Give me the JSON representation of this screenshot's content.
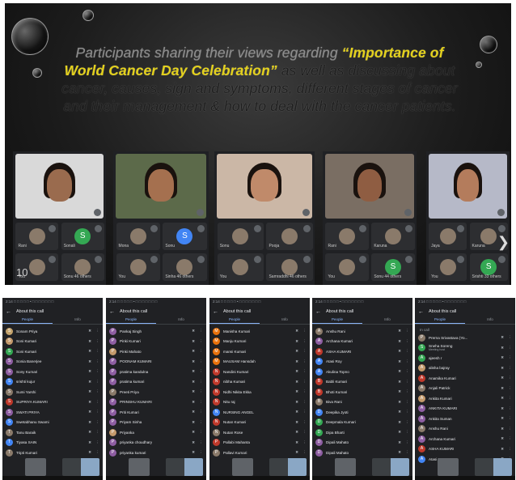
{
  "caption": {
    "p1": "Participants sharing their views regarding ",
    "p2": "“Importance of World Cancer Day Celebration”",
    "p3": " as well as discussing about cancer, causes, sign and symptoms, different stages of cancer and their management & how to deal with the cancer patients."
  },
  "page_number": "10",
  "next_arrow": "❯",
  "call_screens": [
    {
      "tiles": [
        {
          "name": "Rani",
          "letter": ""
        },
        {
          "name": "Sonali",
          "letter": "S"
        },
        {
          "name": "You",
          "letter": ""
        },
        {
          "name": "Sonu",
          "letter": "",
          "extra": "46 others"
        }
      ]
    },
    {
      "tiles": [
        {
          "name": "Mona",
          "letter": ""
        },
        {
          "name": "Sonu",
          "letter": "S"
        },
        {
          "name": "You",
          "letter": ""
        },
        {
          "name": "Sinha",
          "letter": "",
          "extra": "46 others"
        }
      ]
    },
    {
      "tiles": [
        {
          "name": "Sonu",
          "letter": ""
        },
        {
          "name": "Pooja",
          "letter": ""
        },
        {
          "name": "You",
          "letter": ""
        },
        {
          "name": "Samraddhi",
          "letter": "",
          "extra": "46 others"
        }
      ]
    },
    {
      "tiles": [
        {
          "name": "Rani",
          "letter": ""
        },
        {
          "name": "Karuna",
          "letter": ""
        },
        {
          "name": "You",
          "letter": ""
        },
        {
          "name": "Sonu",
          "letter": "S",
          "extra": "44 others"
        }
      ]
    },
    {
      "tiles": [
        {
          "name": "Jaya",
          "letter": ""
        },
        {
          "name": "Karuna",
          "letter": ""
        },
        {
          "name": "You",
          "letter": ""
        },
        {
          "name": "Srishti",
          "letter": "S",
          "extra": "33 others"
        }
      ]
    }
  ],
  "people_screens": [
    {
      "status": "2:14 □ □ □ □ □ •   □ □ □ □ □ □ □",
      "title": "About this call",
      "tab_people": "People",
      "tab_info": "Info",
      "rows": [
        {
          "name": "Sonam Priya",
          "color": "#c5a46d"
        },
        {
          "name": "Soni Kumari",
          "color": "#c49a6c"
        },
        {
          "name": "Soni Kumari",
          "color": "#34a853"
        },
        {
          "name": "Sonia Banerjee",
          "color": "#8e5ea2"
        },
        {
          "name": "Sony Kumari",
          "color": "#8e5ea2"
        },
        {
          "name": "srishti kujur",
          "color": "#4285f4"
        },
        {
          "name": "Sumi Yarshi",
          "color": "#8a7a6a"
        },
        {
          "name": "SUPRIYA KUMARI",
          "color": "#c0392b"
        },
        {
          "name": "SWATI PRIYA",
          "color": "#8e5ea2"
        },
        {
          "name": "Swetabhanu Swami",
          "color": "#4285f4"
        },
        {
          "name": "Tanu Baraik",
          "color": "#8a7a6a"
        },
        {
          "name": "Tiyasa SAIN",
          "color": "#4285f4"
        },
        {
          "name": "Tripti Kumari",
          "color": "#8a7a6a"
        }
      ]
    },
    {
      "status": "2:14 □ □ □ □ □ •   □ □ □ □ □ □ □",
      "title": "About this call",
      "tab_people": "People",
      "tab_info": "Info",
      "rows": [
        {
          "name": "Pankaj Singh",
          "color": "#8e5ea2"
        },
        {
          "name": "Pinki Kumari",
          "color": "#8e5ea2"
        },
        {
          "name": "Pinki Mahato",
          "color": "#c49a6c"
        },
        {
          "name": "POONAM KUMARI",
          "color": "#8e5ea2"
        },
        {
          "name": "pratima kandulna",
          "color": "#8e5ea2"
        },
        {
          "name": "pratima kumari",
          "color": "#8e5ea2"
        },
        {
          "name": "Preeti Priya",
          "color": "#8a7a6a"
        },
        {
          "name": "PRINSHU KUMARI",
          "color": "#8e5ea2"
        },
        {
          "name": "Priti Kumari",
          "color": "#8e5ea2"
        },
        {
          "name": "Priyam Sinha",
          "color": "#8e5ea2"
        },
        {
          "name": "Priyanka",
          "color": "#c49a6c"
        },
        {
          "name": "priyanka choudhary",
          "color": "#8e5ea2"
        },
        {
          "name": "priyanka kumari",
          "color": "#8e5ea2"
        }
      ]
    },
    {
      "status": "2:14 □ □ □ □ □ •   □ □ □ □ □ □ □",
      "title": "About this call",
      "tab_people": "People",
      "tab_info": "Info",
      "rows": [
        {
          "name": "Manisha Kumari",
          "color": "#e8710a"
        },
        {
          "name": "Manju Kumari",
          "color": "#e8710a"
        },
        {
          "name": "mansi Kumari",
          "color": "#e8710a"
        },
        {
          "name": "MAUSAM Hansdah",
          "color": "#e8710a"
        },
        {
          "name": "Nandini Kumari",
          "color": "#c0392b"
        },
        {
          "name": "nibha Kumari",
          "color": "#c0392b"
        },
        {
          "name": "Nidhi Nikita Ekka",
          "color": "#c0392b"
        },
        {
          "name": "Nitu raj",
          "color": "#c0392b"
        },
        {
          "name": "NURSING ANGEL",
          "color": "#4285f4"
        },
        {
          "name": "Nutan Kumari",
          "color": "#c0392b"
        },
        {
          "name": "Nutan Rose",
          "color": "#8a7a6a"
        },
        {
          "name": "Pallabi Mahanta",
          "color": "#c0392b"
        },
        {
          "name": "Pallavi Kumari",
          "color": "#8a7a6a"
        }
      ]
    },
    {
      "status": "2:14 □ □ □ □ □ •   □ □ □ □ □ □ □",
      "title": "About this call",
      "tab_people": "People",
      "tab_info": "Info",
      "rows": [
        {
          "name": "Anshu Rani",
          "color": "#8a7a6a"
        },
        {
          "name": "Archana Kumari",
          "color": "#8e5ea2"
        },
        {
          "name": "ASHA KUMARI",
          "color": "#c0392b"
        },
        {
          "name": "Atasi Roy",
          "color": "#4285f4"
        },
        {
          "name": "Akulina Topno",
          "color": "#4285f4"
        },
        {
          "name": "Babli Kumari",
          "color": "#c0392b"
        },
        {
          "name": "Bhoti Kumari",
          "color": "#c0392b"
        },
        {
          "name": "Biva Rani",
          "color": "#8a7a6a"
        },
        {
          "name": "Deepika Jyoti",
          "color": "#4285f4"
        },
        {
          "name": "Deepmala Kumari",
          "color": "#34a853"
        },
        {
          "name": "Dipa Bharti",
          "color": "#34a853"
        },
        {
          "name": "Dipali Mahato",
          "color": "#8e5ea2"
        },
        {
          "name": "Dipali Mahato",
          "color": "#8e5ea2"
        }
      ]
    },
    {
      "status": "2:14 □ □ □ □ □ •   □ □ □ □ □ □ □",
      "title": "About this call",
      "tab_people": "People",
      "tab_info": "Info",
      "in_call": "In call",
      "rows": [
        {
          "name": "Prerna Srivastava (Yo...",
          "color": "#8a7a6a"
        },
        {
          "name": "Sneha Soreng",
          "color": "#34a853"
        },
        {
          "name": "ajeesh r",
          "color": "#34a853"
        },
        {
          "name": "alisha bajray",
          "color": "#c49a6c"
        },
        {
          "name": "Anamika Kumari",
          "color": "#c0392b"
        },
        {
          "name": "Anjali Patrick",
          "color": "#8a7a6a"
        },
        {
          "name": "Ankita Kumari",
          "color": "#c49a6c"
        },
        {
          "name": "ANKITA KUMARI",
          "color": "#8e5ea2"
        },
        {
          "name": "Ankita Suman",
          "color": "#8e5ea2"
        },
        {
          "name": "Anshu Rani",
          "color": "#8a7a6a"
        },
        {
          "name": "Archana Kumari",
          "color": "#8e5ea2"
        },
        {
          "name": "ASHA KUMARI",
          "color": "#c0392b"
        },
        {
          "name": "Atasi Roy",
          "color": "#4285f4"
        }
      ],
      "sub": "Meeting host"
    }
  ]
}
